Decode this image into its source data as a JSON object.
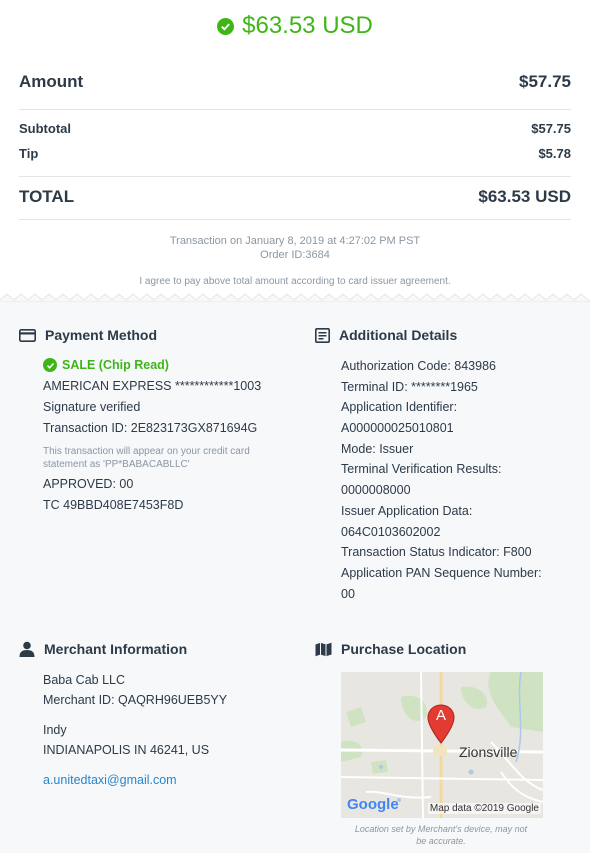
{
  "header": {
    "total": "$63.53 USD"
  },
  "summary": {
    "amount_label": "Amount",
    "amount_value": "$57.75",
    "subtotal_label": "Subtotal",
    "subtotal_value": "$57.75",
    "tip_label": "Tip",
    "tip_value": "$5.78",
    "total_label": "TOTAL",
    "total_value": "$63.53 USD"
  },
  "transaction": {
    "datetime": "Transaction on January 8, 2019 at 4:27:02 PM PST",
    "order_id": "Order ID:3684",
    "agreement": "I agree to pay above total amount according to card issuer agreement."
  },
  "payment": {
    "title": "Payment Method",
    "status": "SALE (Chip Read)",
    "card": "AMERICAN EXPRESS ************1003",
    "signature": "Signature verified",
    "transaction_id": "Transaction ID: 2E823173GX871694G",
    "statement_note_1": "This transaction will appear on your credit card",
    "statement_note_2": "statement as 'PP*BABACABLLC'",
    "approved": "APPROVED: 00",
    "tc": "TC 49BBD408E7453F8D"
  },
  "details": {
    "title": "Additional Details",
    "lines": [
      "Authorization Code: 843986",
      "Terminal ID: ********1965",
      "Application Identifier:",
      "A000000025010801",
      "Mode: Issuer",
      "Terminal Verification Results:",
      "0000008000",
      "Issuer Application Data:",
      "064C0103602002",
      "Transaction Status Indicator: F800",
      "Application PAN Sequence Number:",
      "00"
    ]
  },
  "merchant": {
    "title": "Merchant Information",
    "name": "Baba Cab  LLC",
    "merchant_id": "Merchant ID: QAQRH96UEB5YY",
    "city": "Indy",
    "address": "INDIANAPOLIS IN 46241, US",
    "email": "a.unitedtaxi@gmail.com"
  },
  "location": {
    "title": "Purchase Location",
    "map_town": "Zionsville",
    "map_pin_letter": "A",
    "map_brand": "Google",
    "map_credit": "Map data ©2019 Google",
    "note_1": "Location set by Merchant's device, may not",
    "note_2": "be accurate."
  },
  "colors": {
    "success": "#3fb618",
    "link": "#2a86c9",
    "muted": "#8a97a3",
    "text": "#2d3a48"
  }
}
